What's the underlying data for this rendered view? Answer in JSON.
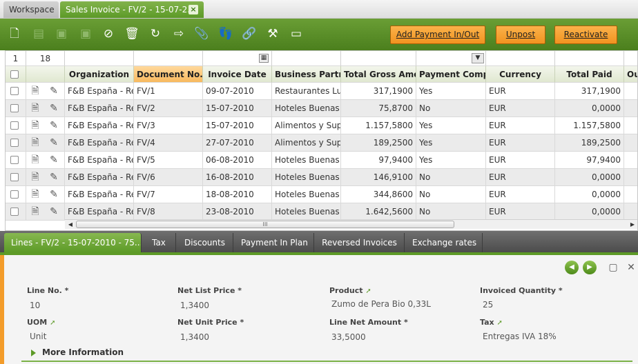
{
  "tabs": {
    "workspace": "Workspace",
    "invoice": "Sales Invoice - FV/2 - 15-07-2...",
    "close": "×"
  },
  "toolbar": {
    "icons": [
      "new-document-icon",
      "new-record-icon",
      "save-icon",
      "save-close-icon",
      "cancel-icon",
      "delete-icon",
      "refresh-icon",
      "export-icon",
      "attachment-icon",
      "audit-trail-icon",
      "link-icon",
      "tools-icon",
      "toggle-view-icon"
    ],
    "add_payment": "Add Payment In/Out",
    "unpost": "Unpost",
    "reactivate": "Reactivate"
  },
  "grid": {
    "count_left": "1",
    "count_right": "18",
    "columns": [
      "Organization",
      "Document No.",
      "Invoice Date",
      "Business Partner",
      "Total Gross Amount",
      "Payment Complete",
      "Currency",
      "Total Paid",
      "Outs"
    ],
    "sort_indicator": "▲",
    "rows": [
      [
        "F&B España - Re",
        "FV/1",
        "09-07-2010",
        "Restaurantes Lu",
        "317,1900",
        "Yes",
        "EUR",
        "317,1900"
      ],
      [
        "F&B España - Re",
        "FV/2",
        "15-07-2010",
        "Hoteles Buenas",
        "75,8700",
        "No",
        "EUR",
        "0,0000"
      ],
      [
        "F&B España - Re",
        "FV/3",
        "15-07-2010",
        "Alimentos y Supe",
        "1.157,5800",
        "Yes",
        "EUR",
        "1.157,5800"
      ],
      [
        "F&B España - Re",
        "FV/4",
        "27-07-2010",
        "Alimentos y Supe",
        "189,2500",
        "Yes",
        "EUR",
        "189,2500"
      ],
      [
        "F&B España - Re",
        "FV/5",
        "06-08-2010",
        "Hoteles Buenas",
        "97,9400",
        "Yes",
        "EUR",
        "97,9400"
      ],
      [
        "F&B España - Re",
        "FV/6",
        "16-08-2010",
        "Hoteles Buenas",
        "146,9100",
        "No",
        "EUR",
        "0,0000"
      ],
      [
        "F&B España - Re",
        "FV/7",
        "18-08-2010",
        "Hoteles Buenas",
        "344,8600",
        "No",
        "EUR",
        "0,0000"
      ],
      [
        "F&B España - Re",
        "FV/8",
        "23-08-2010",
        "Hoteles Buenas",
        "1.642,5600",
        "No",
        "EUR",
        "0,0000"
      ]
    ],
    "scroll_grip": "III"
  },
  "subtabs": [
    "Lines - FV/2 - 15-07-2010 - 75...",
    "Tax",
    "Discounts",
    "Payment In Plan",
    "Reversed Invoices",
    "Exchange rates"
  ],
  "detail": {
    "fields": [
      {
        "label": "Line No. *",
        "value": "10"
      },
      {
        "label": "Net List Price *",
        "value": "1,3400"
      },
      {
        "label": "Product",
        "value": "Zumo de Pera Bio 0,33L"
      },
      {
        "label": "Invoiced Quantity *",
        "value": "25"
      },
      {
        "label": "UOM",
        "value": "Unit"
      },
      {
        "label": "Net Unit Price *",
        "value": "1,3400"
      },
      {
        "label": "Line Net Amount *",
        "value": "33,5000"
      },
      {
        "label": "Tax",
        "value": "Entregas IVA 18%"
      }
    ],
    "more_info": "More Information"
  },
  "colors": {
    "accent_green": "#5d9a27",
    "button_orange": "#f19320",
    "sort_header": "#f8b95e"
  }
}
